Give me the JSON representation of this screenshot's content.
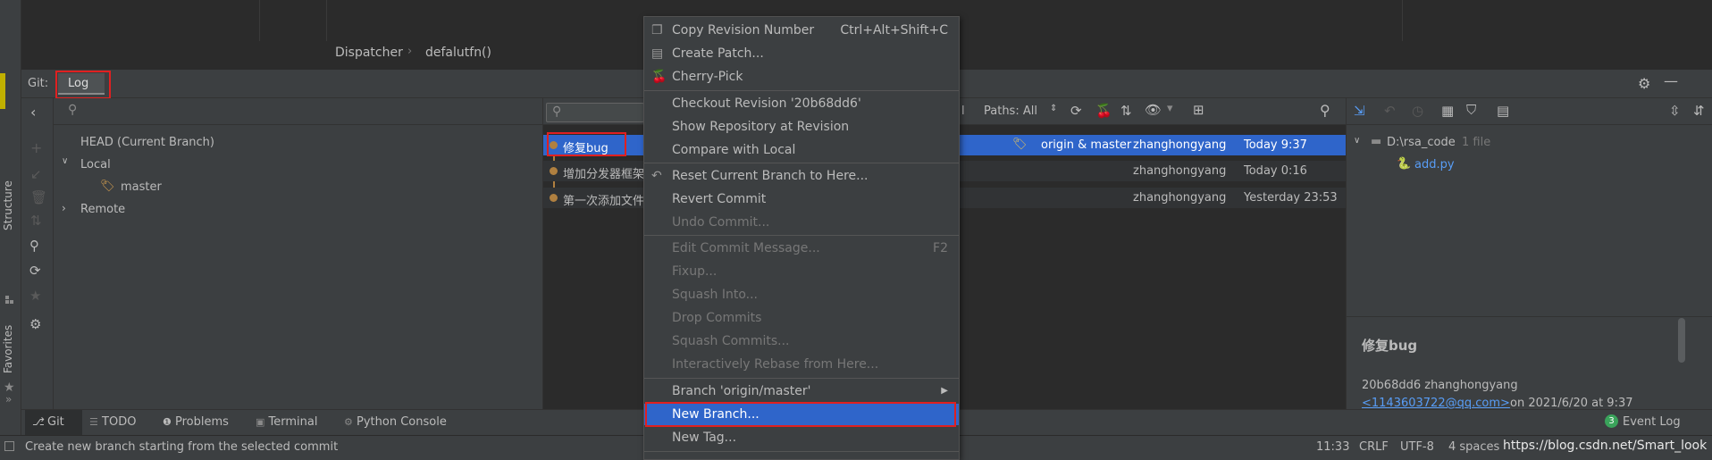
{
  "editor": {
    "breadcrumb": [
      "Dispatcher",
      "defalutfn()"
    ],
    "breadcrumb_sep": "›"
  },
  "git_header": {
    "prefix": "Git:",
    "tab_label": "Log"
  },
  "branches": {
    "head": "HEAD (Current Branch)",
    "local": "Local",
    "local_branch": "master",
    "remote": "Remote"
  },
  "log_toolbar": {
    "filter_partial": "l",
    "paths": "Paths: All"
  },
  "commits": [
    {
      "message": "修复bug",
      "refs": "origin & master",
      "author": "zhanghongyang",
      "date": "Today 9:37"
    },
    {
      "message": "增加分发器框架",
      "refs": "",
      "author": "zhanghongyang",
      "date": "Today 0:16"
    },
    {
      "message": "第一次添加文件",
      "refs": "",
      "author": "zhanghongyang",
      "date": "Yesterday 23:53"
    }
  ],
  "changes": {
    "root": "D:\\rsa_code",
    "root_count": "1 file",
    "file": "add.py",
    "detail_title": "修复bug",
    "detail_hash_author": "20b68dd6 zhanghongyang",
    "detail_email": "<1143603722@qq.com>",
    "detail_date": "on 2021/6/20 at 9:37"
  },
  "context_menu": {
    "items": [
      {
        "label": "Copy Revision Number",
        "shortcut": "Ctrl+Alt+Shift+C",
        "icon": "copy-icon",
        "disabled": false
      },
      {
        "label": "Create Patch...",
        "shortcut": "",
        "icon": "patch-icon",
        "disabled": false
      },
      {
        "label": "Cherry-Pick",
        "shortcut": "",
        "icon": "cherry-icon",
        "disabled": false
      },
      {
        "label": "Checkout Revision '20b68dd6'",
        "shortcut": "",
        "icon": "",
        "disabled": false
      },
      {
        "label": "Show Repository at Revision",
        "shortcut": "",
        "icon": "",
        "disabled": false
      },
      {
        "label": "Compare with Local",
        "shortcut": "",
        "icon": "",
        "disabled": false
      },
      {
        "label": "Reset Current Branch to Here...",
        "shortcut": "",
        "icon": "undo-icon",
        "disabled": false
      },
      {
        "label": "Revert Commit",
        "shortcut": "",
        "icon": "",
        "disabled": false
      },
      {
        "label": "Undo Commit...",
        "shortcut": "",
        "icon": "",
        "disabled": true
      },
      {
        "label": "Edit Commit Message...",
        "shortcut": "F2",
        "icon": "",
        "disabled": true
      },
      {
        "label": "Fixup...",
        "shortcut": "",
        "icon": "",
        "disabled": true
      },
      {
        "label": "Squash Into...",
        "shortcut": "",
        "icon": "",
        "disabled": true
      },
      {
        "label": "Drop Commits",
        "shortcut": "",
        "icon": "",
        "disabled": true
      },
      {
        "label": "Squash Commits...",
        "shortcut": "",
        "icon": "",
        "disabled": true
      },
      {
        "label": "Interactively Rebase from Here...",
        "shortcut": "",
        "icon": "",
        "disabled": true
      },
      {
        "label": "Branch 'origin/master'",
        "shortcut": "",
        "icon": "",
        "disabled": false
      },
      {
        "label": "New Branch...",
        "shortcut": "",
        "icon": "",
        "disabled": false,
        "selected": true
      },
      {
        "label": "New Tag...",
        "shortcut": "",
        "icon": "",
        "disabled": false
      }
    ]
  },
  "tool_tabs": [
    "Git",
    "TODO",
    "Problems",
    "Terminal",
    "Python Console"
  ],
  "event_log": {
    "count": "3",
    "label": "Event Log"
  },
  "side_tabs": {
    "structure": "Structure",
    "favorites": "Favorites"
  },
  "status": {
    "message": "Create new branch starting from the selected commit",
    "position": "11:33",
    "line_sep": "CRLF",
    "encoding": "UTF-8",
    "indent": "4 spaces",
    "watermark": "https://blog.csdn.net/Smart_look"
  },
  "colors": {
    "selection": "#2f65ca",
    "annotation_red": "#e02020",
    "commit_dot": "#b08040",
    "link": "#589df6"
  }
}
